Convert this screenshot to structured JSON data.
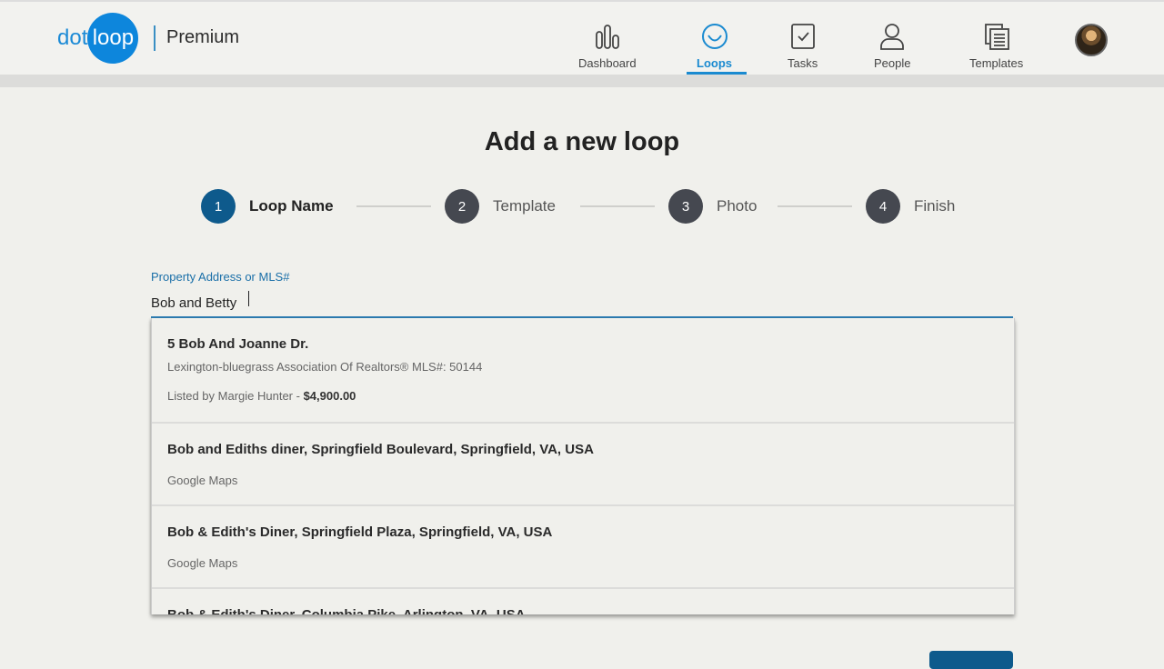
{
  "header": {
    "logo": {
      "dot": "dot",
      "loop": "loop"
    },
    "plan": "Premium",
    "nav": [
      {
        "label": "Dashboard",
        "icon": "bar-chart-icon",
        "active": false
      },
      {
        "label": "Loops",
        "icon": "loop-smile-icon",
        "active": true
      },
      {
        "label": "Tasks",
        "icon": "checkbox-icon",
        "active": false
      },
      {
        "label": "People",
        "icon": "person-icon",
        "active": false
      },
      {
        "label": "Templates",
        "icon": "documents-icon",
        "active": false
      }
    ],
    "avatar": "user-avatar"
  },
  "page": {
    "title": "Add a new loop",
    "steps": [
      {
        "num": "1",
        "label": "Loop Name",
        "active": true
      },
      {
        "num": "2",
        "label": "Template",
        "active": false
      },
      {
        "num": "3",
        "label": "Photo",
        "active": false
      },
      {
        "num": "4",
        "label": "Finish",
        "active": false
      }
    ],
    "field": {
      "label": "Property Address or MLS#",
      "value": "Bob and Betty"
    },
    "suggestions": [
      {
        "main": "5 Bob And Joanne Dr.",
        "sub1": "Lexington-bluegrass Association Of Realtors® MLS#: 50144",
        "sub2_prefix": "Listed by Margie Hunter - ",
        "sub2_price": "$4,900.00"
      },
      {
        "main": "Bob and Ediths diner, Springfield Boulevard, Springfield, VA, USA",
        "sub": "Google Maps"
      },
      {
        "main": "Bob & Edith's Diner, Springfield Plaza, Springfield, VA, USA",
        "sub": "Google Maps"
      },
      {
        "main": "Bob & Edith's Diner, Columbia Pike, Arlington, VA, USA"
      }
    ]
  },
  "colors": {
    "accent": "#1a8ad0",
    "brand": "#0d86dc",
    "step_active": "#0e5a8c",
    "step_inactive": "#454850"
  }
}
